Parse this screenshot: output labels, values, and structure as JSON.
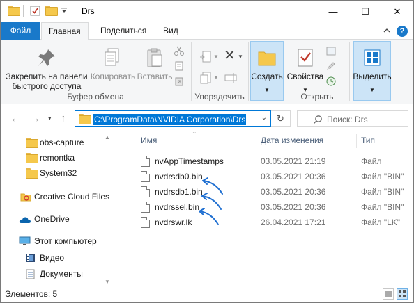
{
  "window": {
    "title": "Drs",
    "controls": {
      "minimize": "—",
      "maximize": "☐",
      "close": "✕"
    }
  },
  "ribbon_tabs": {
    "file": "Файл",
    "home": "Главная",
    "share": "Поделиться",
    "view": "Вид",
    "help": "?"
  },
  "ribbon": {
    "pin": "Закрепить на панели быстрого доступа",
    "pin_line1": "Закрепить на панели",
    "pin_line2": "быстрого доступа",
    "copy": "Копировать",
    "paste": "Вставить",
    "group_clipboard": "Буфер обмена",
    "group_organize": "Упорядочить",
    "create": "Создать",
    "properties": "Свойства",
    "group_open": "Открыть",
    "select": "Выделить"
  },
  "address": {
    "path": "C:\\ProgramData\\NVIDIA Corporation\\Drs",
    "search_placeholder": "Поиск: Drs"
  },
  "nav_pane": {
    "items": [
      {
        "label": "obs-capture",
        "icon": "folder-icon"
      },
      {
        "label": "remontka",
        "icon": "folder-icon"
      },
      {
        "label": "System32",
        "icon": "folder-icon"
      },
      {
        "label": "Creative Cloud Files",
        "icon": "creative-cloud-icon"
      },
      {
        "label": "OneDrive",
        "icon": "onedrive-icon"
      },
      {
        "label": "Этот компьютер",
        "icon": "computer-icon"
      },
      {
        "label": "Видео",
        "icon": "video-icon"
      },
      {
        "label": "Документы",
        "icon": "documents-icon"
      }
    ]
  },
  "file_list": {
    "columns": {
      "name": "Имя",
      "date": "Дата изменения",
      "type": "Тип"
    },
    "rows": [
      {
        "name": "nvAppTimestamps",
        "date": "03.05.2021 21:19",
        "type": "Файл"
      },
      {
        "name": "nvdrsdb0.bin",
        "date": "03.05.2021 20:36",
        "type": "Файл \"BIN\""
      },
      {
        "name": "nvdrsdb1.bin",
        "date": "03.05.2021 20:36",
        "type": "Файл \"BIN\""
      },
      {
        "name": "nvdrssel.bin",
        "date": "03.05.2021 20:36",
        "type": "Файл \"BIN\""
      },
      {
        "name": "nvdrswr.lk",
        "date": "26.04.2021 17:21",
        "type": "Файл \"LK\""
      }
    ]
  },
  "status": {
    "count": "Элементов: 5"
  },
  "colors": {
    "accent": "#0078d7",
    "file_tab": "#1979ca",
    "folder": "#f5c84c",
    "arrow": "#1f6fd1"
  }
}
